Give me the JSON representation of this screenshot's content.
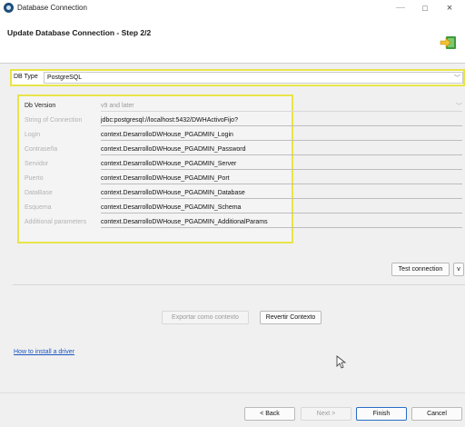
{
  "window": {
    "title": "Database Connection",
    "close_glyph": "×",
    "minimize_glyph": "—",
    "maximize_glyph": "□"
  },
  "header": {
    "title": "Update Database Connection - Step 2/2"
  },
  "db_type": {
    "label": "DB Type",
    "value": "PostgreSQL"
  },
  "connection": {
    "rows": [
      {
        "label": "Db Version",
        "value": "v9 and later"
      },
      {
        "label": "String of Connection",
        "value": "jdbc:postgresql://localhost:5432/DWHActivoFijo?"
      },
      {
        "label": "Login",
        "value": "context.DesarrolloDWHouse_PGADMIN_Login"
      },
      {
        "label": "Contraseña",
        "value": "context.DesarrolloDWHouse_PGADMIN_Password"
      },
      {
        "label": "Servidor",
        "value": "context.DesarrolloDWHouse_PGADMIN_Server"
      },
      {
        "label": "Puerto",
        "value": "context.DesarrolloDWHouse_PGADMIN_Port"
      },
      {
        "label": "DataBase",
        "value": "context.DesarrolloDWHouse_PGADMIN_Database"
      },
      {
        "label": "Esquema",
        "value": "context.DesarrolloDWHouse_PGADMIN_Schema"
      },
      {
        "label": "Additional parameters",
        "value": "context.DesarrolloDWHouse_PGADMIN_AdditionalParams"
      }
    ]
  },
  "actions": {
    "test_connection": "Test connection",
    "test_more": "v",
    "export_context": "Exportar como contexto",
    "revert_context": "Revertir Contexto"
  },
  "links": {
    "install_driver": "How to install a driver"
  },
  "footer": {
    "back": "< Back",
    "next": "Next >",
    "finish": "Finish",
    "cancel": "Cancel"
  },
  "colors": {
    "highlight": "#e8e44a",
    "link": "#1a56c4",
    "primary_border": "#2a6fc7"
  }
}
